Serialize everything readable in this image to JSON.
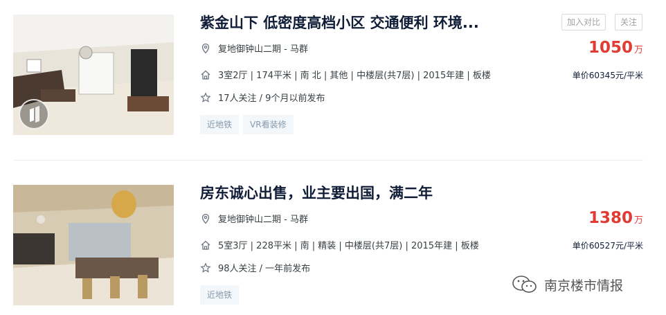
{
  "listings": [
    {
      "title": "紫金山下 低密度高档小区 交通便利 环境...",
      "community": "复地御钟山二期 - 马群",
      "house_info": "3室2厅 | 174平米 | 南 北 | 其他 | 中楼层(共7层) | 2015年建 | 板楼",
      "follow_info": "17人关注 / 9个月以前发布",
      "tags": [
        "近地铁",
        "VR看装修"
      ],
      "compare_label": "加入对比",
      "follow_label": "关注",
      "total_price": "1050",
      "price_unit": "万",
      "unit_price": "单价60345元/平米"
    },
    {
      "title": "房东诚心出售，业主要出国，满二年",
      "community": "复地御钟山二期 - 马群",
      "house_info": "5室3厅 | 228平米 | 南 | 精装 | 中楼层(共7层) | 2015年建 | 板楼",
      "follow_info": "98人关注 / 一年前发布",
      "tags": [
        "近地铁"
      ],
      "total_price": "1380",
      "price_unit": "万",
      "unit_price": "单价60527元/平米"
    }
  ],
  "watermark": "南京楼市情报",
  "colors": {
    "price": "#e13c34",
    "tag_bg": "#f4f7f9",
    "tag_text": "#849aae"
  }
}
